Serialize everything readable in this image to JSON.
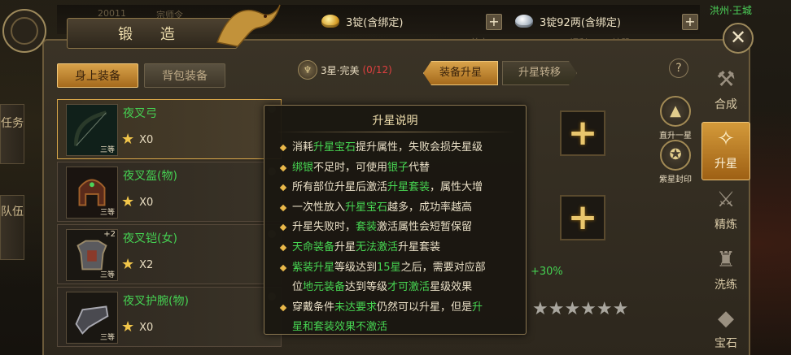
{
  "top_bar": {
    "gold_text": "3锭(含绑定)",
    "silver_text": "3锭92两(含绑定)",
    "plus_label": "+",
    "top_right_name": "洪州·王城",
    "faded_texts": [
      "20011",
      "宗师令",
      "首充",
      "福利",
      "神器BOSS"
    ]
  },
  "window": {
    "title": "锻 造",
    "close_label": "✕"
  },
  "left_tabs": {
    "equipped": "身上装备",
    "bag": "背包装备"
  },
  "side_tabs": {
    "task": "任务",
    "team": "队伍"
  },
  "equipment": [
    {
      "name": "夜叉弓",
      "count": "X0",
      "grade": "三等",
      "plus": ""
    },
    {
      "name": "夜叉盔(物)",
      "count": "X0",
      "grade": "三等",
      "plus": ""
    },
    {
      "name": "夜叉铠(女)",
      "count": "X2",
      "grade": "三等",
      "plus": "+2"
    },
    {
      "name": "夜叉护腕(物)",
      "count": "X0",
      "grade": "三等",
      "plus": ""
    }
  ],
  "star_info": {
    "emblem_label": "♆",
    "label": "3星·完美",
    "progress": "(0/12)"
  },
  "sub_tabs": {
    "upgrade": "装备升星",
    "transfer": "升星转移"
  },
  "help_label": "?",
  "gem_plus": "+",
  "bonus_text": "+30%",
  "stars_row": "★★★★★★",
  "action_buttons": {
    "direct_upgrade": "直升一星",
    "seal": "紫星封印",
    "direct_icon": "▲",
    "seal_icon": "✪"
  },
  "menu": [
    {
      "icon": "⚒",
      "label": "合成"
    },
    {
      "icon": "✧",
      "label": "升星"
    },
    {
      "icon": "⚔",
      "label": "精炼"
    },
    {
      "icon": "♜",
      "label": "洗练"
    },
    {
      "icon": "◆",
      "label": "宝石"
    }
  ],
  "tooltip": {
    "title": "升星说明",
    "l1a": "消耗",
    "l1b": "升星宝石",
    "l1c": "提升属性，失败会损失星级",
    "l2a": "绑银",
    "l2b": "不足时，可使用",
    "l2c": "银子",
    "l2d": "代替",
    "l3a": "所有部位升星后激活",
    "l3b": "升星套装",
    "l3c": "，属性大增",
    "l4a": "一次性放入",
    "l4b": "升星宝石",
    "l4c": "越多，成功率越高",
    "l5a": "升星失败时，",
    "l5b": "套装",
    "l5c": "激活属性会短暂保留",
    "l6a": "天命装备",
    "l6b": "升星",
    "l6c": "无法激活",
    "l6d": "升星套装",
    "l7a": "紫装升星",
    "l7b": "等级达到",
    "l7c": "15星",
    "l7d": "之后，需要对应部",
    "l7e": "位",
    "l7f": "地元装备",
    "l7g": "达到等级",
    "l7h": "才可激活",
    "l7i": "星级效果",
    "l8a": "穿戴条件",
    "l8b": "未达要求",
    "l8c": "仍然可以升星，但是",
    "l8d": "升",
    "l8e": "星和套装效果不激活"
  }
}
